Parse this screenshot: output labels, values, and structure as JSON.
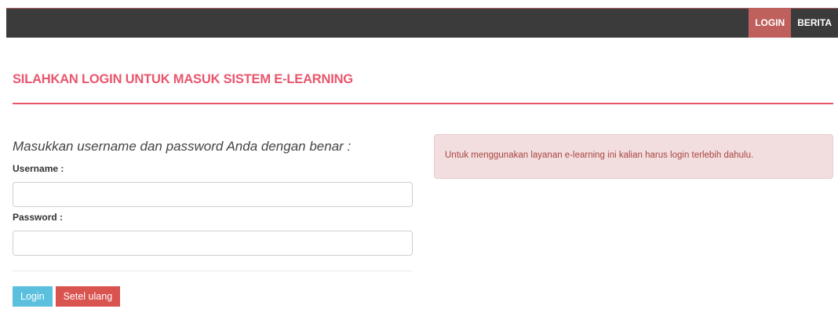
{
  "nav": {
    "items": [
      {
        "label": "LOGIN",
        "active": true
      },
      {
        "label": "BERITA",
        "active": false
      }
    ]
  },
  "page": {
    "title": "SILAHKAN LOGIN UNTUK MASUK SISTEM E-LEARNING"
  },
  "form": {
    "instruction": "Masukkan username dan password Anda dengan benar :",
    "username_label": "Username :",
    "username_value": "",
    "password_label": "Password :",
    "password_value": "",
    "login_label": "Login",
    "reset_label": "Setel ulang"
  },
  "alert": {
    "message": "Untuk menggunakan layanan e-learning ini kalian harus login terlebih dahulu."
  },
  "colors": {
    "navbar": "#3b3b3b",
    "nav_active": "#c0605c",
    "title": "#e8566d",
    "login_button": "#5bc0de",
    "reset_button": "#d9534f",
    "alert_bg": "#f2dede",
    "alert_text": "#a94442"
  }
}
